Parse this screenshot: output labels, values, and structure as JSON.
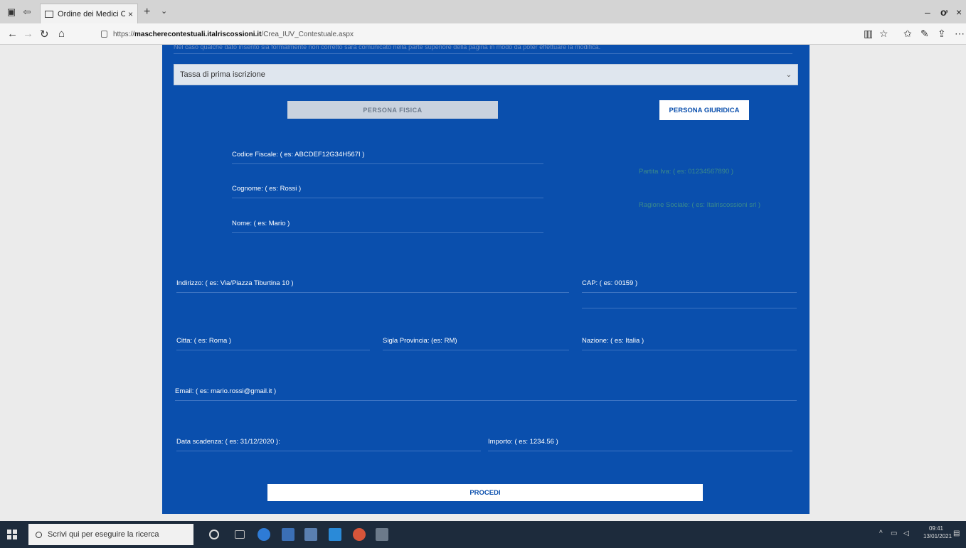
{
  "browser": {
    "tab_title": "Ordine dei Medici Chiru",
    "tab_close": "×",
    "new_tab": "+",
    "tab_menu": "⌄",
    "url_prefix": "https://",
    "url_host": "maschere­contestuali.italriscossioni.it",
    "url_path": "/Crea_IUV_Contestuale.aspx"
  },
  "form": {
    "notice": "Nel caso qualche dato inserito sia formalmente non corretto sarà comunicato nella parte superiore della pagina in modo da poter effettuare la modifica.",
    "tax_select": "Tassa di prima iscrizione",
    "btn_persona_fisica": "PERSONA FISICA",
    "btn_persona_giuridica": "PERSONA GIURIDICA",
    "codice_fiscale": "Codice Fiscale: ( es: ABCDEF12G34H567I )",
    "cognome": "Cognome: ( es: Rossi )",
    "nome": "Nome: ( es: Mario )",
    "partita_iva": "Partita Iva: ( es: 01234567890 )",
    "ragione_sociale": "Ragione Sociale: ( es: Italriscossioni srl )",
    "indirizzo": "Indirizzo: ( es: Via/Piazza Tiburtina 10 )",
    "cap": "CAP: ( es: 00159 )",
    "citta": "Citta: ( es: Roma )",
    "sigla_provincia": "Sigla Provincia: (es: RM)",
    "nazione": "Nazione: ( es: Italia )",
    "email": "Email: ( es: mario.rossi@gmail.it )",
    "data_scadenza": "Data scadenza: ( es: 31/12/2020 ):",
    "importo": "Importo: ( es: 1234.56 )",
    "btn_procedi": "PROCEDI"
  },
  "taskbar": {
    "search_placeholder": "Scrivi qui per eseguire la ricerca",
    "time": "09:41",
    "date": "13/01/2021"
  }
}
